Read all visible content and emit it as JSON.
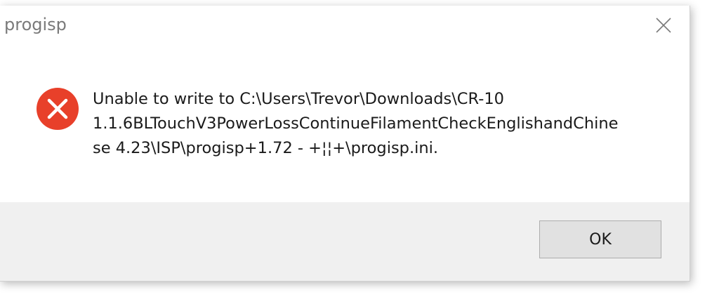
{
  "window": {
    "title": "progisp",
    "close_icon": "close-icon"
  },
  "message": {
    "icon": "error-icon",
    "icon_color": "#e8402a",
    "text": "Unable to write to C:\\Users\\Trevor\\Downloads\\CR-10\n1.1.6BLTouchV3PowerLossContinueFilamentCheckEnglishandChine\nse 4.23\\ISP\\progisp+1.72 - +¦¦+\\progisp.ini."
  },
  "buttons": {
    "ok_label": "OK"
  }
}
